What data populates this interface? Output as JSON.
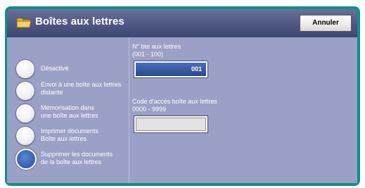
{
  "header": {
    "title": "Boîtes aux lettres",
    "icon": "folder-icon",
    "cancel_label": "Annuler"
  },
  "options": [
    {
      "label": "Désactivé",
      "selected": false
    },
    {
      "label": "Envoi à une boîte aux lettres\ndistante",
      "selected": false
    },
    {
      "label": "Mémorisation dans\nune boîte aux lettres",
      "selected": false
    },
    {
      "label": "Imprimer documents\nBoîte aux lettres",
      "selected": false
    },
    {
      "label": "Supprimer les documents\nde la boîte aux lettres",
      "selected": true
    }
  ],
  "mailbox_number": {
    "label": "N° bte aux lettres\n(001 - 100)",
    "value": "001"
  },
  "access_code": {
    "label": "Code d'accès boîte aux lettres\n0000 - 9999",
    "value": ""
  },
  "colors": {
    "frame": "#0f8e8e",
    "header": "#4e5682",
    "panel": "#9ba0c6",
    "selected": "#3a62b5"
  }
}
